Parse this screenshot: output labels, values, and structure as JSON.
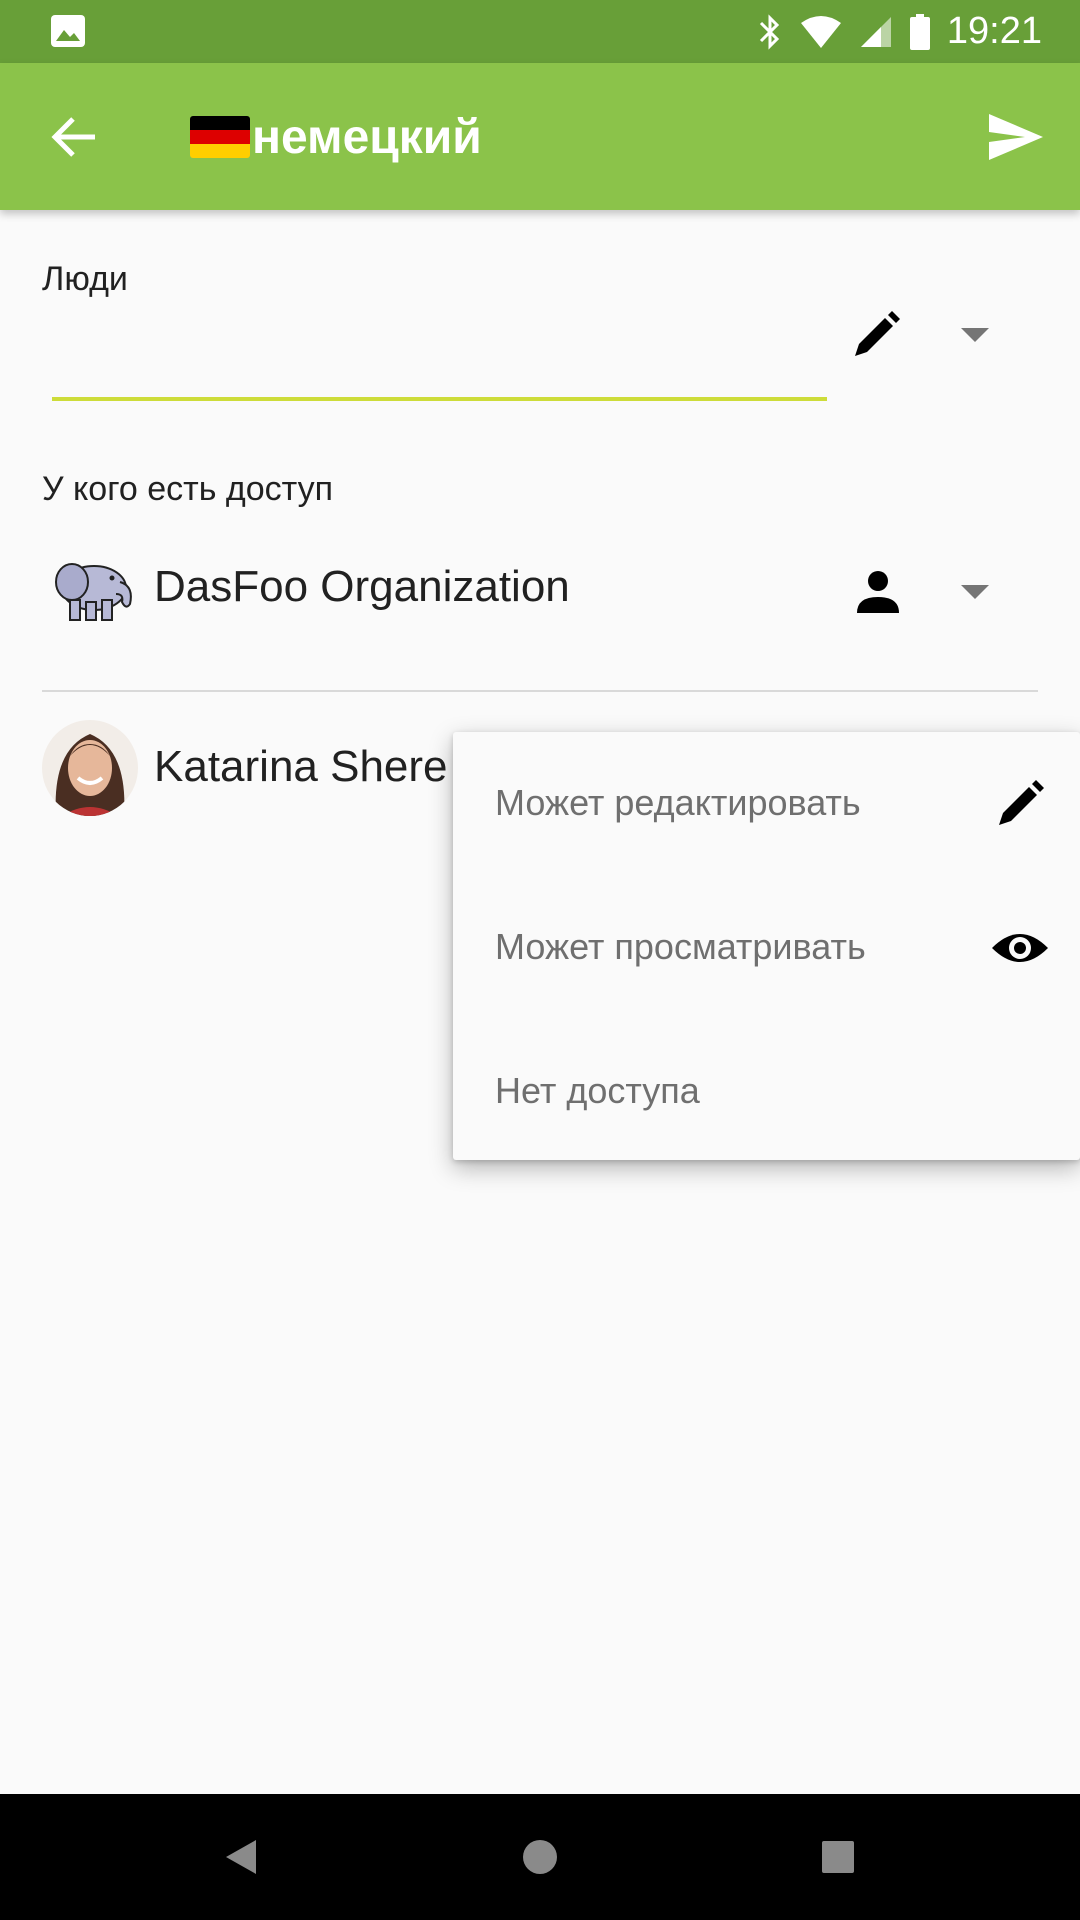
{
  "status_bar": {
    "time": "19:21",
    "icons": [
      "image-icon",
      "bluetooth-icon",
      "wifi-icon",
      "cell-signal-icon",
      "battery-icon"
    ]
  },
  "app_bar": {
    "back_icon": "arrow-back-icon",
    "flag_icon": "germany-flag-icon",
    "title": "немецкий",
    "send_icon": "send-icon",
    "background": "#8bc34a",
    "status_bar_color": "#689f38"
  },
  "people": {
    "label": "Люди",
    "input_value": "",
    "edit_icon": "pencil-icon",
    "dropdown_icon": "triangle-down-icon",
    "accent": "#cddc39"
  },
  "access": {
    "label": "У кого есть доступ",
    "entries": [
      {
        "name": "DasFoo Organization",
        "avatar": "elephant-avatar",
        "permission_icon": "person-icon"
      },
      {
        "name": "Katarina Shere",
        "avatar": "user-photo-avatar"
      }
    ]
  },
  "permission_menu": {
    "items": [
      {
        "label": "Может редактировать",
        "icon": "pencil-icon"
      },
      {
        "label": "Может просматривать",
        "icon": "eye-icon"
      },
      {
        "label": "Нет доступа",
        "icon": ""
      }
    ]
  },
  "nav_bar": {
    "buttons": [
      "back-triangle-icon",
      "home-circle-icon",
      "recents-square-icon"
    ]
  }
}
